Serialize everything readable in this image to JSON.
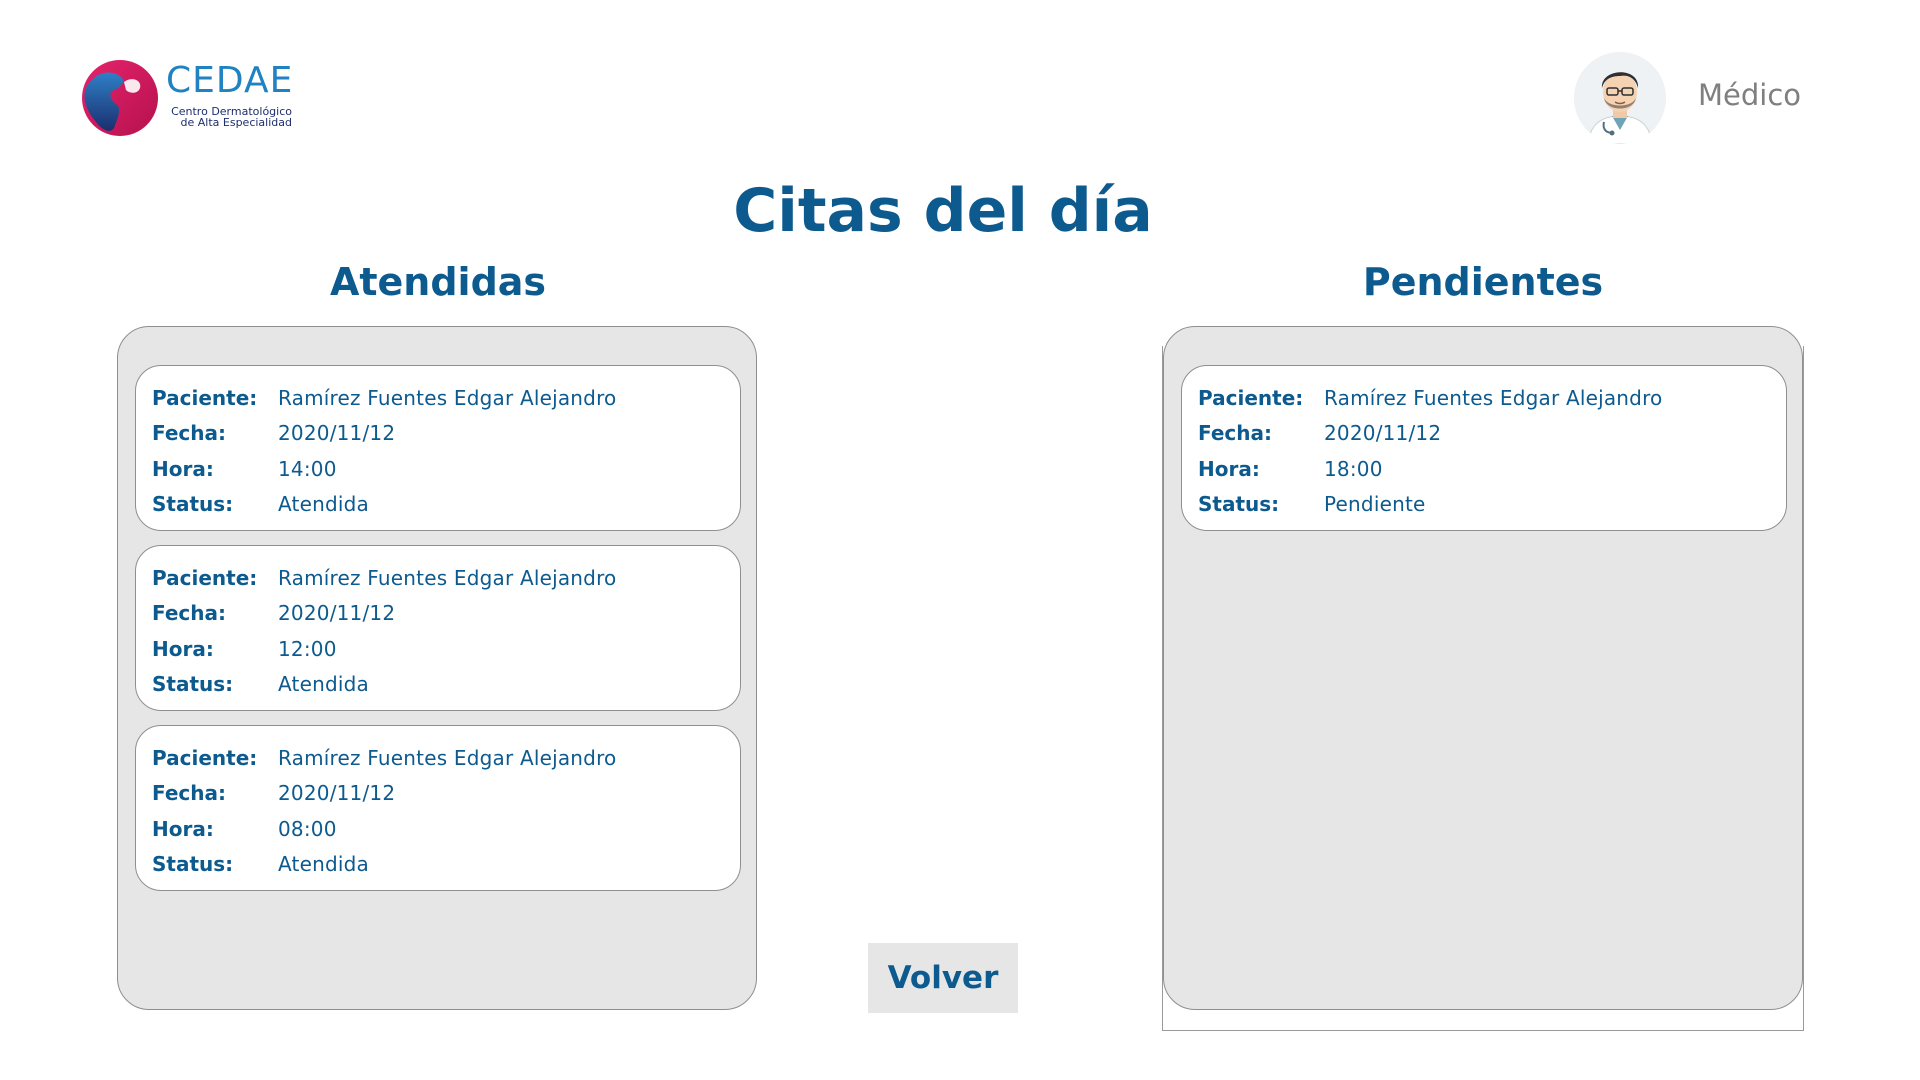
{
  "header": {
    "logo": {
      "name": "CEDAE",
      "tagline": "Centro Dermatológico de Alta Especialidad"
    },
    "user": {
      "role": "Médico",
      "avatar_icon": "doctor-avatar-icon"
    }
  },
  "page": {
    "title": "Citas del día"
  },
  "columns": {
    "attended": {
      "title": "Atendidas",
      "cards": [
        {
          "rows": [
            {
              "label": "Paciente:",
              "value": "Ramírez Fuentes Edgar Alejandro"
            },
            {
              "label": "Fecha:",
              "value": "2020/11/12"
            },
            {
              "label": "Hora:",
              "value": "14:00"
            },
            {
              "label": "Status:",
              "value": "Atendida"
            }
          ]
        },
        {
          "rows": [
            {
              "label": "Paciente:",
              "value": "Ramírez Fuentes Edgar Alejandro"
            },
            {
              "label": "Fecha:",
              "value": "2020/11/12"
            },
            {
              "label": "Hora:",
              "value": "12:00"
            },
            {
              "label": "Status:",
              "value": "Atendida"
            }
          ]
        },
        {
          "rows": [
            {
              "label": "Paciente:",
              "value": "Ramírez Fuentes Edgar Alejandro"
            },
            {
              "label": "Fecha:",
              "value": "2020/11/12"
            },
            {
              "label": "Hora:",
              "value": "08:00"
            },
            {
              "label": "Status:",
              "value": "Atendida"
            }
          ]
        }
      ]
    },
    "pending": {
      "title": "Pendientes",
      "cards": [
        {
          "rows": [
            {
              "label": "Paciente:",
              "value": "Ramírez Fuentes Edgar Alejandro"
            },
            {
              "label": "Fecha:",
              "value": "2020/11/12"
            },
            {
              "label": "Hora:",
              "value": "18:00"
            },
            {
              "label": "Status:",
              "value": "Pendiente"
            }
          ]
        }
      ]
    }
  },
  "actions": {
    "back_label": "Volver"
  },
  "colors": {
    "primary_text": "#0d5a8f",
    "panel_bg": "#e6e6e6",
    "card_bg": "#ffffff",
    "logo_blue": "#1f82c3",
    "logo_magenta": "#d4155f"
  }
}
